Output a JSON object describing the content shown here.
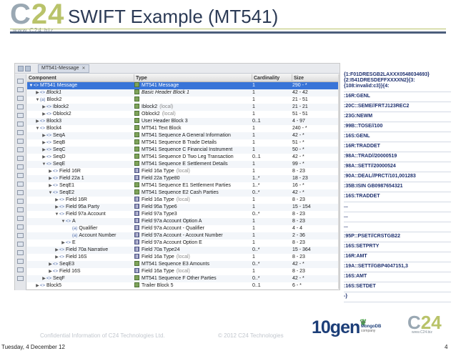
{
  "header": {
    "logo_main": "C",
    "logo_digits": "24",
    "logo_sub": "www.C24.biz",
    "title": "SWIFT Example (MT541)"
  },
  "ide": {
    "tab_label": "MT541-Message",
    "columns": [
      "Component",
      "Type",
      "Cardinality",
      "Size"
    ],
    "rows": [
      {
        "depth": 0,
        "twisty": "▼",
        "kind": "<>",
        "name": "MT541 Message",
        "type_icon": "complex",
        "type": "MT541 Message",
        "type_style": "",
        "card": "1",
        "size": "290 - *",
        "selected": true
      },
      {
        "depth": 1,
        "twisty": "▶",
        "kind": "<>",
        "name": "Block1",
        "name_style": "it",
        "type_icon": "complex",
        "type": "Basic Header Block 1",
        "type_style": "it",
        "card": "1",
        "size": "42 - 42"
      },
      {
        "depth": 1,
        "twisty": "▼",
        "kind": "(a)",
        "name": "Block2",
        "type_icon": "complex",
        "type": "",
        "type_style": "",
        "card": "1",
        "size": "21 - 51"
      },
      {
        "depth": 2,
        "twisty": "▶",
        "kind": "<>",
        "name": "Iblock2",
        "type_icon": "complex",
        "type": "Iblock2",
        "type_local": "(local)",
        "card": "1",
        "size": "21 - 21"
      },
      {
        "depth": 2,
        "twisty": "▶",
        "kind": "<>",
        "name": "Oblock2",
        "type_icon": "complex",
        "type": "Oblock2",
        "type_local": "(local)",
        "card": "1",
        "size": "51 - 51"
      },
      {
        "depth": 1,
        "twisty": "▶",
        "kind": "<>",
        "name": "Block3",
        "type_icon": "complex",
        "type": "User Header Block 3",
        "card": "0..1",
        "size": "4 - 97"
      },
      {
        "depth": 1,
        "twisty": "▼",
        "kind": "<>",
        "name": "Block4",
        "type_icon": "complex",
        "type": "MT541 Text Block",
        "card": "1",
        "size": "240 - *"
      },
      {
        "depth": 2,
        "twisty": "▶",
        "kind": "<>",
        "name": "SeqA",
        "type_icon": "complex",
        "type": "MT541 Sequence A General Information",
        "card": "1",
        "size": "42 - *"
      },
      {
        "depth": 2,
        "twisty": "▶",
        "kind": "<>",
        "name": "SeqB",
        "type_icon": "complex",
        "type": "MT541 Sequence B Trade Details",
        "card": "1",
        "size": "51 - *"
      },
      {
        "depth": 2,
        "twisty": "▶",
        "kind": "<>",
        "name": "SeqC",
        "type_icon": "complex",
        "type": "MT541 Sequence C Financial Instrument",
        "card": "1",
        "size": "50 - *"
      },
      {
        "depth": 2,
        "twisty": "▶",
        "kind": "<>",
        "name": "SeqD",
        "type_icon": "complex",
        "type": "MT541 Sequence D Two Leg Transaction",
        "card": "0..1",
        "size": "42 - *"
      },
      {
        "depth": 2,
        "twisty": "▼",
        "kind": "<>",
        "name": "SeqE",
        "type_icon": "complex",
        "type": "MT541 Sequence E Settlement Details",
        "card": "1",
        "size": "99 - *"
      },
      {
        "depth": 3,
        "twisty": "▶",
        "kind": "<>",
        "name": "Field 16R",
        "type_icon": "field",
        "type": "Field 16a Type",
        "type_local": "(local)",
        "card": "1",
        "size": "8 - 23"
      },
      {
        "depth": 3,
        "twisty": "▶",
        "kind": "<>",
        "name": "Field 22a 1",
        "type_icon": "field",
        "type": "Field 22a Type80",
        "card": "1..*",
        "size": "18 - 23"
      },
      {
        "depth": 3,
        "twisty": "▶",
        "kind": "<>",
        "name": "SeqE1",
        "type_icon": "complex",
        "type": "MT541 Sequence E1 Settlement Parties",
        "card": "1..*",
        "size": "16 - *"
      },
      {
        "depth": 3,
        "twisty": "▼",
        "kind": "<>",
        "name": "SeqE2",
        "type_icon": "complex",
        "type": "MT541 Sequence E2 Cash Parties",
        "card": "0..*",
        "size": "42 - *"
      },
      {
        "depth": 4,
        "twisty": "▶",
        "kind": "<>",
        "name": "Field 16R",
        "type_icon": "field",
        "type": "Field 16a Type",
        "type_local": "(local)",
        "card": "1",
        "size": "8 - 23"
      },
      {
        "depth": 4,
        "twisty": "▶",
        "kind": "<>",
        "name": "Field 95a Party",
        "type_icon": "field",
        "type": "Field 95a Type6",
        "card": "1",
        "size": "15 - 154"
      },
      {
        "depth": 4,
        "twisty": "▼",
        "kind": "<>",
        "name": "Field 97a Account",
        "type_icon": "field",
        "type": "Field 97a Type3",
        "card": "0..*",
        "size": "8 - 23"
      },
      {
        "depth": 5,
        "twisty": "▼",
        "kind": "<>",
        "name": "A",
        "type_icon": "field",
        "type": "Field 97a Account Option A",
        "card": "1",
        "size": "8 - 23"
      },
      {
        "depth": 6,
        "twisty": "",
        "kind": "(a)",
        "name": "Qualifier",
        "type_icon": "field",
        "type": "Field 97a Account - Qualifier",
        "card": "1",
        "size": "4 - 4"
      },
      {
        "depth": 6,
        "twisty": "",
        "kind": "(a)",
        "name": "Account Number",
        "type_icon": "field",
        "type": "Field 97a Account - Account Number",
        "card": "1",
        "size": "2 - 36"
      },
      {
        "depth": 5,
        "twisty": "▶",
        "kind": "<>",
        "name": "E",
        "type_icon": "field",
        "type": "Field 97a Account Option E",
        "card": "1",
        "size": "8 - 23"
      },
      {
        "depth": 4,
        "twisty": "▶",
        "kind": "<>",
        "name": "Field 70a Narrative",
        "type_icon": "field",
        "type": "Field 70a Type24",
        "card": "0..*",
        "size": "15 - 364"
      },
      {
        "depth": 4,
        "twisty": "▶",
        "kind": "<>",
        "name": "Field 16S",
        "type_icon": "field",
        "type": "Field 16a Type",
        "type_local": "(local)",
        "card": "1",
        "size": "8 - 23"
      },
      {
        "depth": 3,
        "twisty": "▶",
        "kind": "<>",
        "name": "SeqE3",
        "type_icon": "complex",
        "type": "MT541 Sequence E3 Amounts",
        "card": "0..*",
        "size": "42 - *"
      },
      {
        "depth": 3,
        "twisty": "▶",
        "kind": "<>",
        "name": "Field 16S",
        "type_icon": "field",
        "type": "Field 16a Type",
        "type_local": "(local)",
        "card": "1",
        "size": "8 - 23"
      },
      {
        "depth": 2,
        "twisty": "▶",
        "kind": "<>",
        "name": "SeqF",
        "type_icon": "complex",
        "type": "MT541 Sequence F Other Parties",
        "card": "0..*",
        "size": "42 - *"
      },
      {
        "depth": 1,
        "twisty": "▶",
        "kind": "<>",
        "name": "Block5",
        "type_icon": "complex",
        "type": "Trailer Block 5",
        "card": "0..1",
        "size": "6 - *"
      }
    ]
  },
  "message": {
    "lines": [
      "{1:F01DRESGB2LAXXX0548034693}{2:I541DRESDEFFXXXXN2}{3:{108:invalid:c3}}{4:",
      ":16R:GENL",
      ":20C::SEME//FRTJ123REC2",
      ":23G:NEWM",
      ":99B::TOSE//100",
      ":16S:GENL",
      ":16R:TRADDET",
      ":98A::TRAD//20000519",
      ":98A::SETT//20000524",
      ":90A::DEAL//PRCT/101,001283",
      ":35B:ISIN GB0987654321",
      ":16S:TRADDET",
      "...",
      "...",
      "...",
      ":95P::PSET//CRSTGB22",
      ":16S:SETPRTY",
      ":16R:AMT",
      ":19A::SETT//GBP4047151,3",
      ":16S:AMT",
      ":16S:SETDET",
      "-}"
    ]
  },
  "footer": {
    "confidential": "Confidential Information of C24 Technologies Ltd.",
    "copyright": "© 2012 C24 Technologies",
    "date": "Tuesday, 4 December 12",
    "page": "4",
    "partner_logo": "10gen",
    "partner_sub_1": "the",
    "partner_sub_title": "MongoDB",
    "partner_sub_2": "company",
    "footer_logo_main": "C",
    "footer_logo_digits": "24",
    "footer_logo_sub": "www.C24.biz"
  },
  "colors": {
    "title": "#2b3a55",
    "accent_olive": "#b9c36a",
    "logo_grey": "#9aa8b3",
    "selection": "#3874d8",
    "message_text": "#1d2f6e"
  }
}
